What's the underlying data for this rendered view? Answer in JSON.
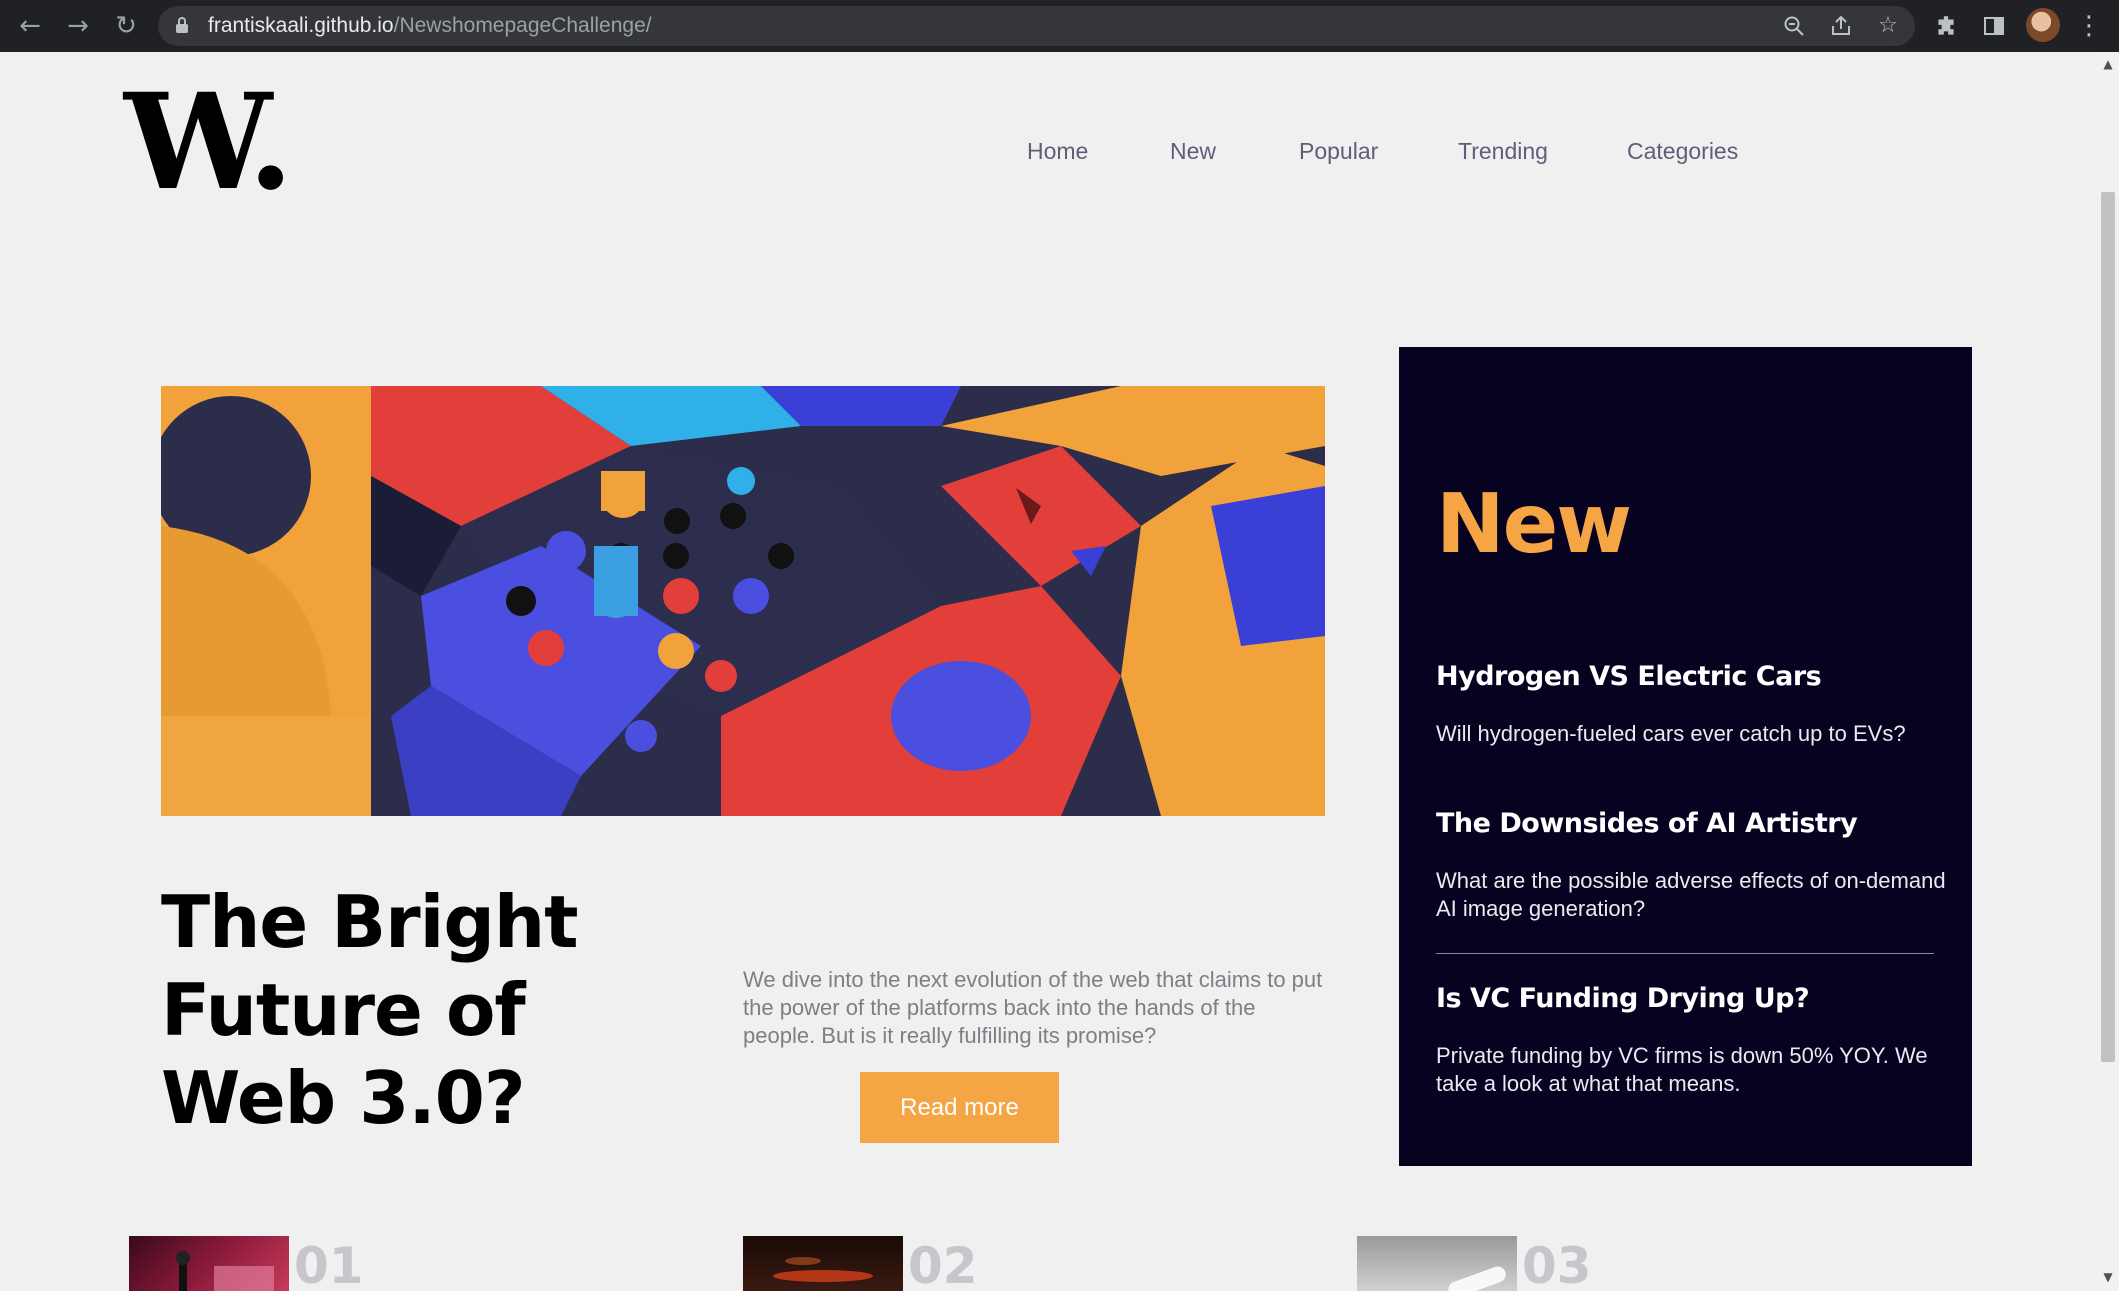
{
  "browser": {
    "url_host": "frantiskaali.github.io",
    "url_path": "/NewshomepageChallenge/",
    "back_icon": "arrow-left",
    "forward_icon": "arrow-right",
    "reload_icon": "reload"
  },
  "site": {
    "logo": "W.",
    "nav": [
      "Home",
      "New",
      "Popular",
      "Trending",
      "Categories"
    ]
  },
  "hero": {
    "image_alt": "colorful 3D blocks and pegs",
    "headline": "The Bright Future of Web 3.0?",
    "intro": "We dive into the next evolution of the web that claims to put the power of the platforms back into the hands of the people. But is it really fulfilling its promise?",
    "cta": "Read more"
  },
  "new_panel": {
    "title": "New",
    "items": [
      {
        "title": "Hydrogen VS Electric Cars",
        "text": "Will hydrogen-fueled cars ever catch up to EVs?"
      },
      {
        "title": "The Downsides of AI Artistry",
        "text": "What are the possible adverse effects of on-demand AI image generation?"
      },
      {
        "title": "Is VC Funding Drying Up?",
        "text": "Private funding by VC firms is down 50% YOY. We take a look at what that means."
      }
    ]
  },
  "numbered": [
    "01",
    "02",
    "03"
  ],
  "colors": {
    "accent": "#f5a544",
    "panel_bg": "#07021f",
    "page_bg": "#f0f0f0"
  }
}
